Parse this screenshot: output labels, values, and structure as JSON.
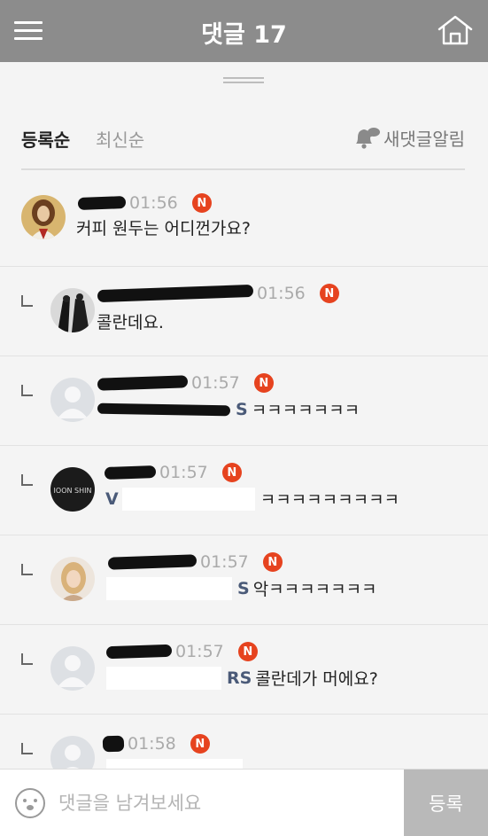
{
  "header": {
    "title": "댓글 17",
    "menu_icon": "hamburger-menu-icon",
    "home_icon": "home-icon",
    "background": "#8c8c8c"
  },
  "sort": {
    "active": "등록순",
    "inactive": "최신순",
    "notify_label": "새댓글알림",
    "notify_icon": "bell-chat-icon"
  },
  "comments": [
    {
      "time": "01:56",
      "badge": "N",
      "text": "커피 원두는 어디껀가요?"
    },
    {
      "time": "01:56",
      "badge": "N",
      "text": "콜란데요."
    },
    {
      "time": "01:57",
      "badge": "N",
      "mention_suffix": "S",
      "text": "ㅋㅋㅋㅋㅋㅋㅋ"
    },
    {
      "time": "01:57",
      "badge": "N",
      "avatar_text": "IOON SHIN",
      "mention_suffix": "V",
      "text": "ㅋㅋㅋㅋㅋㅋㅋㅋㅋ"
    },
    {
      "time": "01:57",
      "badge": "N",
      "mention_suffix": "S",
      "text": "악ㅋㅋㅋㅋㅋㅋㅋ"
    },
    {
      "time": "01:57",
      "badge": "N",
      "mention_suffix": "RS",
      "text": "콜란데가 머에요?"
    },
    {
      "time": "01:58",
      "badge": "N"
    }
  ],
  "input": {
    "placeholder": "댓글을 남겨보세요",
    "emoji_icon": "emoji-face-icon",
    "submit_label": "등록"
  },
  "colors": {
    "badge": "#e6431f",
    "sheet_background": "#f4f4f4",
    "submit_background": "#b9b9b9"
  }
}
